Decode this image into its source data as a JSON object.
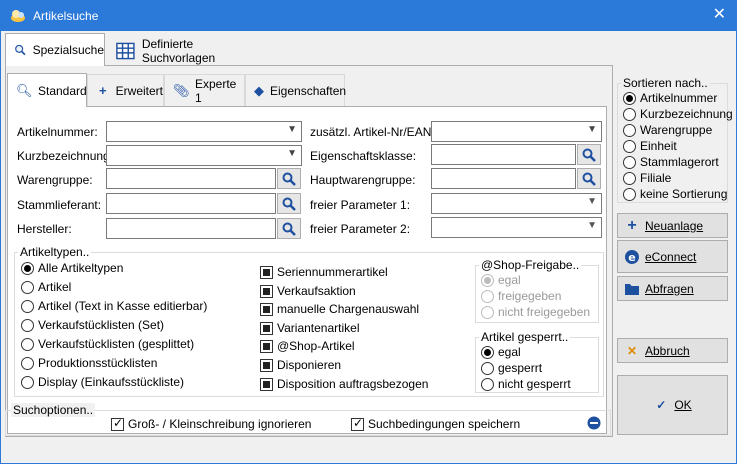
{
  "window": {
    "title": "Artikelsuche",
    "close_glyph": "✕"
  },
  "top_tabs": [
    {
      "label": "Spezialsuche",
      "icon": "magnifier-icon"
    },
    {
      "label": "Definierte Suchvorlagen",
      "icon": "grid-icon"
    }
  ],
  "sub_tabs": [
    {
      "label": "Standard",
      "icon": "search-icon"
    },
    {
      "label": "Erweitert",
      "icon": "plus-icon"
    },
    {
      "label": "Experte 1",
      "icon": "paperclip-icon"
    },
    {
      "label": "Eigenschaften",
      "icon": "shapes-icon"
    }
  ],
  "fields": {
    "artikelnummer": "Artikelnummer:",
    "kurzbezeichnung": "Kurzbezeichnung:",
    "warengruppe": "Warengruppe:",
    "stammlieferant": "Stammlieferant:",
    "hersteller": "Hersteller:",
    "zusaetzl": "zusätzl. Artikel-Nr/EAN:",
    "eigenschaftsklasse": "Eigenschaftsklasse:",
    "hauptwarengruppe": "Hauptwarengruppe:",
    "param1": "freier Parameter 1:",
    "param2": "freier Parameter 2:"
  },
  "artikeltypen": {
    "title": "Artikeltypen..",
    "options": [
      "Alle Artikeltypen",
      "Artikel",
      "Artikel (Text in Kasse editierbar)",
      "Verkaufstücklisten (Set)",
      "Verkaufstücklisten (gesplittet)",
      "Produktionsstücklisten",
      "Display (Einkaufsstückliste)"
    ],
    "selected": 0,
    "checks": [
      "Seriennummerartikel",
      "Verkaufsaktion",
      "manuelle Chargenauswahl",
      "Variantenartikel",
      "@Shop-Artikel",
      "Disponieren",
      "Disposition auftragsbezogen"
    ]
  },
  "shop_freigabe": {
    "title": "@Shop-Freigabe..",
    "options": [
      "egal",
      "freigegeben",
      "nicht freigegeben"
    ],
    "selected": 0
  },
  "artikel_gesperrt": {
    "title": "Artikel gesperrt..",
    "options": [
      "egal",
      "gesperrt",
      "nicht gesperrt"
    ],
    "selected": 0
  },
  "suchoptionen": {
    "title": "Suchoptionen..",
    "case_label": "Groß- / Kleinschreibung ignorieren",
    "save_label": "Suchbedingungen speichern"
  },
  "sortieren": {
    "title": "Sortieren nach..",
    "options": [
      "Artikelnummer",
      "Kurzbezeichnung",
      "Warengruppe",
      "Einheit",
      "Stammlagerort",
      "Filiale",
      "keine Sortierung"
    ],
    "selected": 0
  },
  "buttons": {
    "neuanlage": "Neuanlage",
    "econnect": "eConnect",
    "abfragen": "Abfragen",
    "abbruch": "Abbruch",
    "ok": "OK"
  },
  "colors": {
    "titlebar": "#2b79d8",
    "accent": "#1e50a0",
    "cancel_x": "#e08a00",
    "collapse": "#1e50a0"
  }
}
